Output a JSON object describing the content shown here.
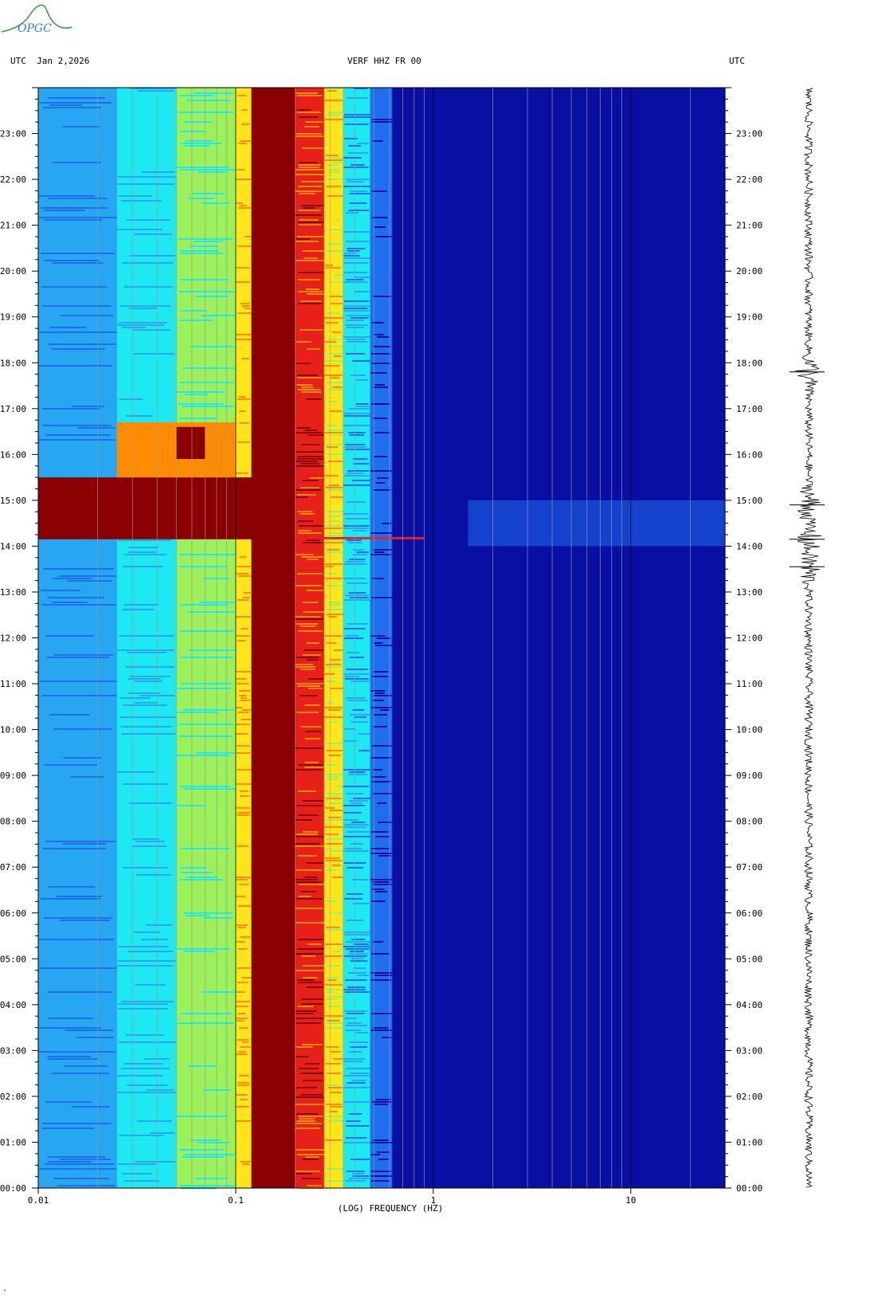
{
  "header": {
    "left": "UTC  Jan 2,2026",
    "center": "VERF HHZ FR 00",
    "right": "UTC"
  },
  "logo_text": "OPGC",
  "corner_mark": "\"",
  "colors": {
    "background_blue": "#0a0fa3",
    "saturated": "#8b0000",
    "red": "#e8201a",
    "orange": "#ff8c00",
    "yellow": "#ffe51a",
    "green": "#9cf05a",
    "cyan": "#1ee8f0",
    "light_blue": "#27a7f0",
    "mid_blue": "#1f6ef0",
    "logo_blue": "#3a7bd5",
    "logo_green": "#2e9a3a"
  },
  "chart_data": {
    "type": "heatmap",
    "title": "VERF HHZ FR 00",
    "xlabel": "(LOG) FREQUENCY (HZ)",
    "ylabel": "UTC",
    "x_scale": "log",
    "xlim": [
      0.01,
      30
    ],
    "x_ticks": [
      {
        "value": 0.01,
        "label": "0.01"
      },
      {
        "value": 0.1,
        "label": "0.1"
      },
      {
        "value": 1,
        "label": "1"
      },
      {
        "value": 10,
        "label": "10"
      }
    ],
    "ylim": [
      0,
      24
    ],
    "y_ticks": [
      "00:00",
      "01:00",
      "02:00",
      "03:00",
      "04:00",
      "05:00",
      "06:00",
      "07:00",
      "08:00",
      "09:00",
      "10:00",
      "11:00",
      "12:00",
      "13:00",
      "14:00",
      "15:00",
      "16:00",
      "17:00",
      "18:00",
      "19:00",
      "20:00",
      "21:00",
      "22:00",
      "23:00"
    ],
    "frequency_bands": [
      {
        "from_hz": 0.01,
        "to_hz": 0.025,
        "level": "light_blue"
      },
      {
        "from_hz": 0.025,
        "to_hz": 0.05,
        "level": "cyan"
      },
      {
        "from_hz": 0.05,
        "to_hz": 0.1,
        "level": "green"
      },
      {
        "from_hz": 0.1,
        "to_hz": 0.12,
        "level": "yellow"
      },
      {
        "from_hz": 0.12,
        "to_hz": 0.2,
        "level": "saturated"
      },
      {
        "from_hz": 0.2,
        "to_hz": 0.28,
        "level": "red"
      },
      {
        "from_hz": 0.28,
        "to_hz": 0.35,
        "level": "yellow"
      },
      {
        "from_hz": 0.35,
        "to_hz": 0.48,
        "level": "cyan"
      },
      {
        "from_hz": 0.48,
        "to_hz": 0.62,
        "level": "mid_blue"
      },
      {
        "from_hz": 0.62,
        "to_hz": 30,
        "level": "background_blue"
      }
    ],
    "events": [
      {
        "start_utc_hour": 14.15,
        "end_utc_hour": 15.5,
        "from_hz": 0.01,
        "to_hz": 0.12,
        "level": "saturated"
      },
      {
        "start_utc_hour": 15.5,
        "end_utc_hour": 16.7,
        "from_hz": 0.025,
        "to_hz": 0.1,
        "level": "orange"
      },
      {
        "start_utc_hour": 15.9,
        "end_utc_hour": 16.6,
        "from_hz": 0.05,
        "to_hz": 0.07,
        "level": "saturated"
      },
      {
        "start_utc_hour": 14.15,
        "end_utc_hour": 14.2,
        "from_hz": 0.28,
        "to_hz": 0.9,
        "level": "red"
      },
      {
        "start_utc_hour": 14.0,
        "end_utc_hour": 15.0,
        "from_hz": 1.5,
        "to_hz": 30,
        "level": "mid_blue"
      }
    ],
    "seismogram": {
      "label": "",
      "notable_events_utc_hour": [
        13.55,
        14.15,
        14.9,
        17.8
      ]
    }
  }
}
